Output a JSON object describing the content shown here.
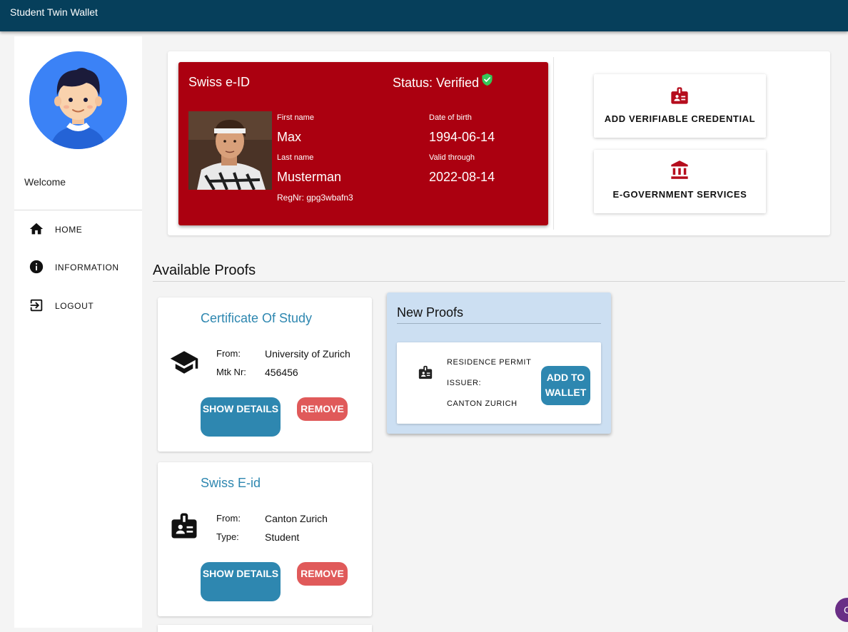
{
  "app": {
    "title": "Student Twin Wallet"
  },
  "sidebar": {
    "welcome": "Welcome",
    "items": [
      {
        "label": "HOME",
        "icon": "home-icon"
      },
      {
        "label": "INFORMATION",
        "icon": "info-icon"
      },
      {
        "label": "LOGOUT",
        "icon": "logout-icon"
      }
    ]
  },
  "eid_card": {
    "title": "Swiss e-ID",
    "status": "Status: Verified",
    "first_name_label": "First name",
    "first_name": "Max",
    "last_name_label": "Last name",
    "last_name": "Musterman",
    "dob_label": "Date of birth",
    "dob": "1994-06-14",
    "valid_label": "Valid through",
    "valid": "2022-08-14",
    "regnr": "RegNr: gpg3wbafn3",
    "color": "#ab0010"
  },
  "actions": {
    "add_credential": "ADD VERIFIABLE CREDENTIAL",
    "egov": "E-GOVERNMENT SERVICES"
  },
  "proofs": {
    "section_title": "Available Proofs",
    "items": [
      {
        "title": "Certificate Of Study",
        "icon": "graduation-cap-icon",
        "label1": "From:",
        "value1": "University of Zurich",
        "label2": "Mtk Nr:",
        "value2": "456456",
        "details": "SHOW DETAILS",
        "remove": "REMOVE"
      },
      {
        "title": "Swiss E-id",
        "icon": "id-badge-icon",
        "label1": "From:",
        "value1": "Canton Zurich",
        "label2": "Type:",
        "value2": "Student",
        "details": "SHOW DETAILS",
        "remove": "REMOVE"
      }
    ]
  },
  "new_proofs": {
    "title": "New Proofs",
    "item": {
      "name": "RESIDENCE PERMIT",
      "issuer_label": "ISSUER:",
      "issuer": "CANTON ZURICH",
      "button": "ADD TO WALLET"
    }
  },
  "chat_fab": {
    "label": "C"
  },
  "colors": {
    "topbar": "#063f5b",
    "accent": "#2e87b0",
    "danger": "#e05a5a",
    "verified": "#34c759"
  }
}
